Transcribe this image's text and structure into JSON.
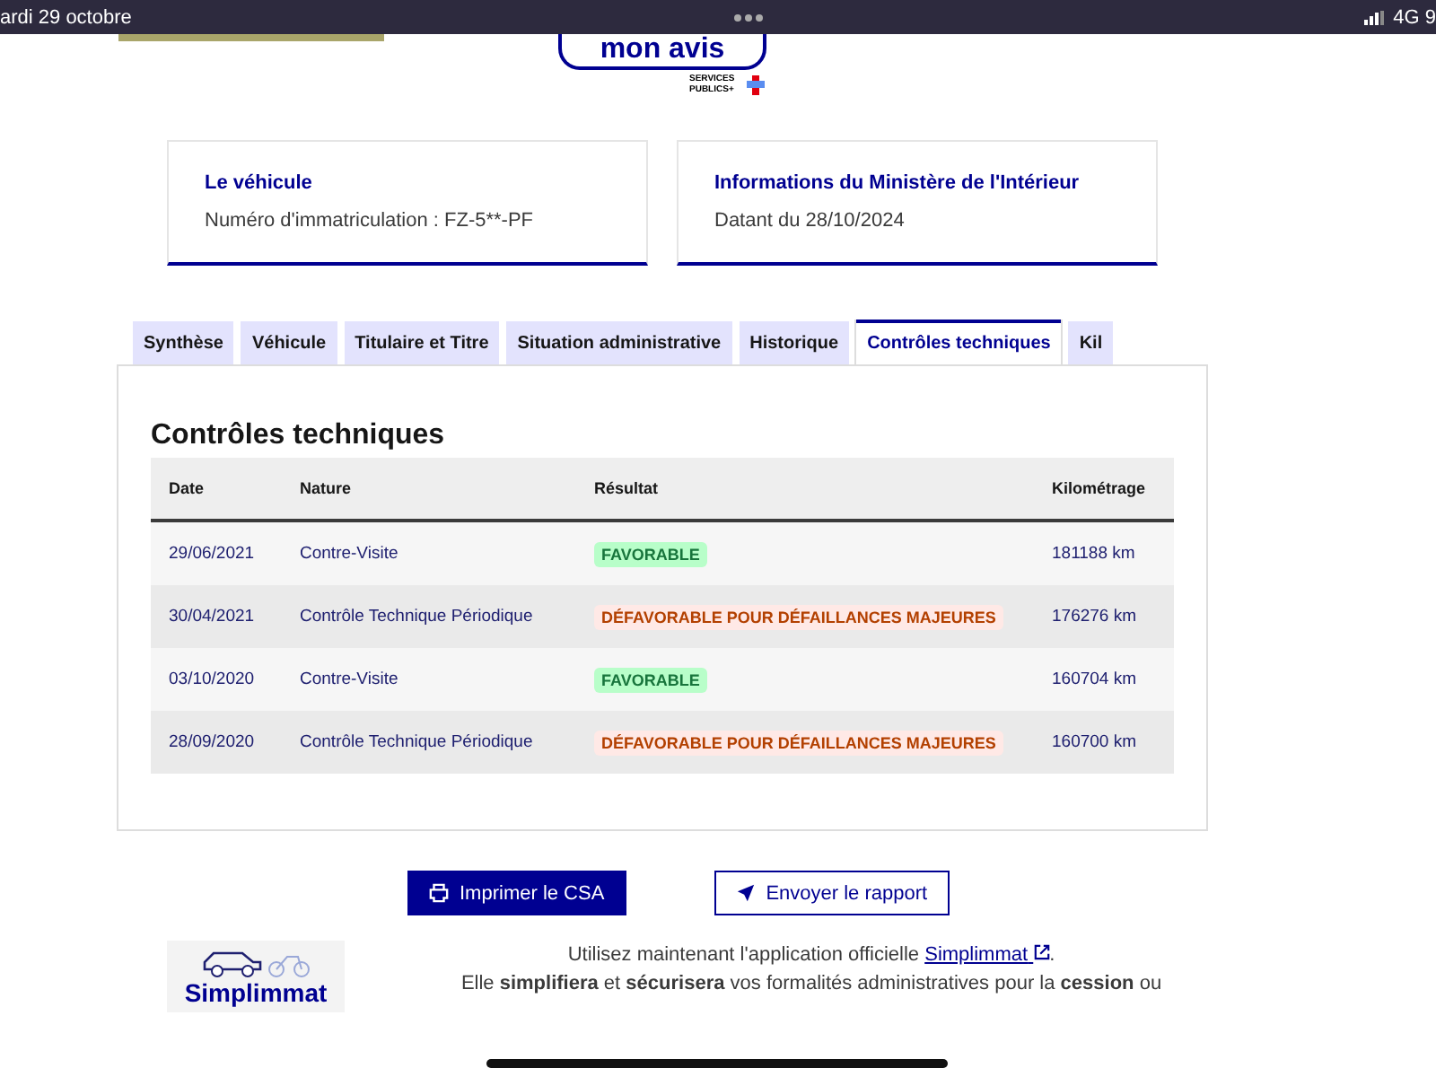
{
  "status_bar": {
    "date": "ardi 29 octobre",
    "network": "4G 9"
  },
  "header": {
    "feedback_button": "mon avis",
    "logo_text": "SERVICES PUBLICS+"
  },
  "cards": [
    {
      "title": "Le véhicule",
      "text": "Numéro d'immatriculation : FZ-5**-PF"
    },
    {
      "title": "Informations du Ministère de l'Intérieur",
      "text": "Datant du 28/10/2024"
    }
  ],
  "tabs": [
    {
      "label": "Synthèse",
      "selected": false
    },
    {
      "label": "Véhicule",
      "selected": false
    },
    {
      "label": "Titulaire et Titre",
      "selected": false
    },
    {
      "label": "Situation administrative",
      "selected": false
    },
    {
      "label": "Historique",
      "selected": false
    },
    {
      "label": "Contrôles techniques",
      "selected": true
    },
    {
      "label": "Kil",
      "selected": false
    }
  ],
  "section_title": "Contrôles techniques",
  "table": {
    "columns": [
      "Date",
      "Nature",
      "Résultat",
      "Kilométrage"
    ],
    "rows": [
      {
        "date": "29/06/2021",
        "nature": "Contre-Visite",
        "result": "FAVORABLE",
        "kind": "favorable",
        "km": "181188 km"
      },
      {
        "date": "30/04/2021",
        "nature": "Contrôle Technique Périodique",
        "result": "DÉFAVORABLE POUR DÉFAILLANCES MAJEURES",
        "kind": "defavorable",
        "km": "176276 km"
      },
      {
        "date": "03/10/2020",
        "nature": "Contre-Visite",
        "result": "FAVORABLE",
        "kind": "favorable",
        "km": "160704 km"
      },
      {
        "date": "28/09/2020",
        "nature": "Contrôle Technique Périodique",
        "result": "DÉFAVORABLE POUR DÉFAILLANCES MAJEURES",
        "kind": "defavorable",
        "km": "160700 km"
      }
    ]
  },
  "buttons": [
    {
      "label": "Imprimer le CSA",
      "kind": "primary"
    },
    {
      "label": "Envoyer le rapport",
      "kind": "secondary"
    }
  ],
  "promo": {
    "logo_text": "Simplimmat",
    "intro": "Utilisez maintenant l'application officielle",
    "link": "Simplimmat",
    "intro_end": ".",
    "line2": "Elle **simplifiera** et **sécurisera** vos formalités administratives pour la **cession** ou"
  }
}
